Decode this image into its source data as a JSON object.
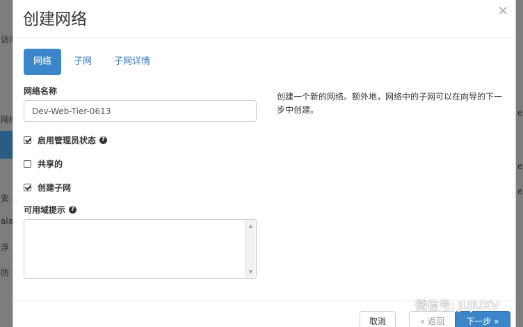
{
  "modal": {
    "title": "创建网络",
    "close_icon": "×"
  },
  "tabs": [
    {
      "label": "网络",
      "active": true
    },
    {
      "label": "子网",
      "active": false
    },
    {
      "label": "子网详情",
      "active": false
    }
  ],
  "form": {
    "network_name_label": "网络名称",
    "network_name_value": "Dev-Web-Tier-0613",
    "admin_state_label": "启用管理员状态",
    "admin_state_checked": true,
    "shared_label": "共享的",
    "shared_checked": false,
    "create_subnet_label": "创建子网",
    "create_subnet_checked": true,
    "az_hints_label": "可用域提示"
  },
  "help_text": "创建一个新的网络。额外地，网络中的子网可以在向导的下一步中创建。",
  "footer": {
    "cancel_label": "取消",
    "back_label": "« 返回",
    "next_label": "下一步 »"
  },
  "background_fragments": {
    "left": [
      "访问",
      "网络",
      "安",
      "ala",
      "浮",
      "防"
    ],
    "right": [
      "e",
      "e",
      "e"
    ]
  },
  "watermark": {
    "text": "微信号: JUJUXV",
    "icon": "wechat-icon"
  },
  "icons": {
    "help": "question-circle-icon",
    "checkbox_checked": "check-icon",
    "scroll_up": "▲",
    "scroll_down": "▼"
  },
  "colors": {
    "accent": "#3a86c8",
    "link": "#337ab7",
    "backdrop": "#6f6f6f"
  }
}
